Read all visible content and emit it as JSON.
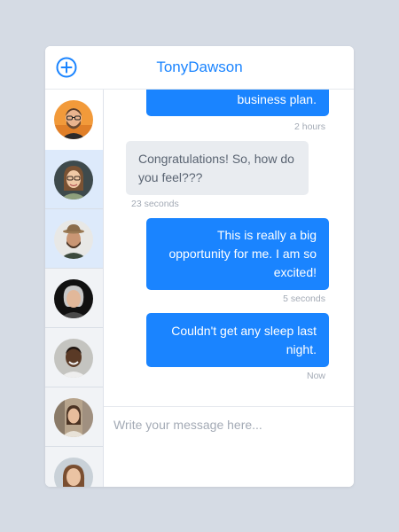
{
  "header": {
    "title": "TonyDawson",
    "add_icon": "plus-circle-icon",
    "accent": "#1a84ff"
  },
  "contacts": [
    {
      "avatar": "avatar-man-glasses-beard",
      "state": "active"
    },
    {
      "avatar": "avatar-woman-glasses",
      "state": "highlight"
    },
    {
      "avatar": "avatar-man-hat-beard",
      "state": "highlight"
    },
    {
      "avatar": "avatar-woman-gray-hair",
      "state": "normal"
    },
    {
      "avatar": "avatar-man-smiling",
      "state": "normal"
    },
    {
      "avatar": "avatar-woman-street",
      "state": "normal"
    },
    {
      "avatar": "avatar-woman-long-hair",
      "state": "normal"
    }
  ],
  "messages": [
    {
      "direction": "outgoing",
      "lines": [
        "business plan."
      ],
      "time": "2 hours"
    },
    {
      "direction": "incoming",
      "lines": [
        "Congratulations! So, how do",
        "you feel???"
      ],
      "time": "23 seconds"
    },
    {
      "direction": "outgoing",
      "lines": [
        "This is really a big",
        "opportunity for me. I am so",
        "excited!"
      ],
      "time": "5 seconds"
    },
    {
      "direction": "outgoing",
      "lines": [
        "Couldn't get any sleep last",
        "night."
      ],
      "time": "Now"
    }
  ],
  "composer": {
    "placeholder": "Write your message here..."
  },
  "colors": {
    "outgoing_bubble": "#1a84ff",
    "incoming_bubble": "#e9ecf0",
    "page_background": "#d5dbe4"
  }
}
